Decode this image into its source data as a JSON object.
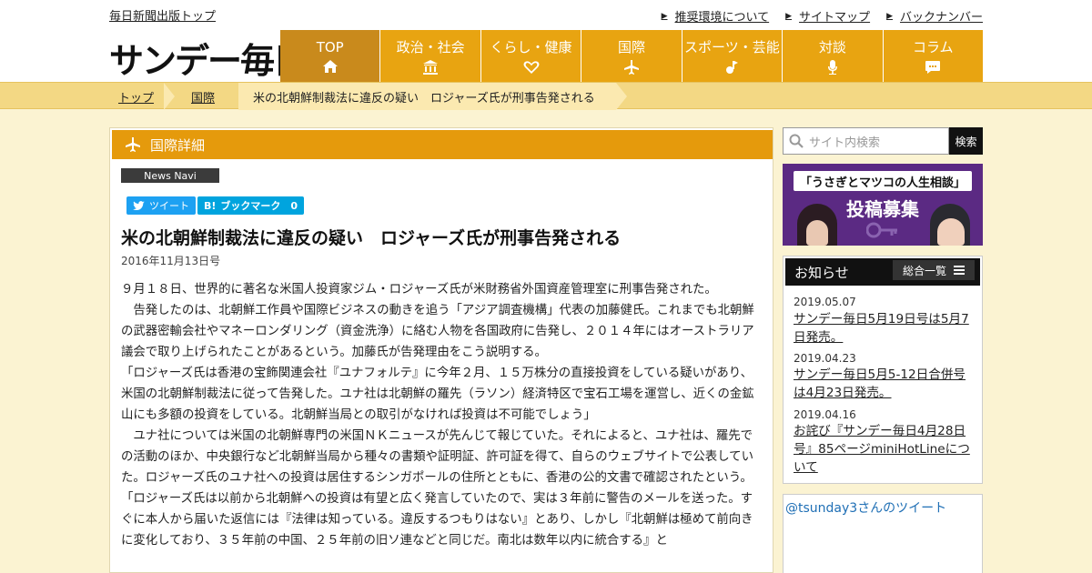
{
  "header": {
    "publisher_link": "毎日新聞出版トップ",
    "logo": "サンデー毎日",
    "util_links": [
      "推奨環境について",
      "サイトマップ",
      "バックナンバー"
    ]
  },
  "nav": [
    {
      "label": "TOP",
      "icon": "home-icon"
    },
    {
      "label": "政治・社会",
      "icon": "institution-icon"
    },
    {
      "label": "くらし・健康",
      "icon": "heart-icon"
    },
    {
      "label": "国際",
      "icon": "airplane-icon"
    },
    {
      "label": "スポーツ・芸能",
      "icon": "mic-note-icon"
    },
    {
      "label": "対談",
      "icon": "microphone-icon"
    },
    {
      "label": "コラム",
      "icon": "speech-bubble-icon"
    }
  ],
  "breadcrumb": {
    "home": "トップ",
    "category": "国際",
    "current": "米の北朝鮮制裁法に違反の疑い　ロジャーズ氏が刑事告発される"
  },
  "section": {
    "title": "国際詳細",
    "badge": "News Navi"
  },
  "share": {
    "tweet": "ツイート",
    "bookmark": "ブックマーク",
    "bookmark_count": "0"
  },
  "article": {
    "title": "米の北朝鮮制裁法に違反の疑い　ロジャーズ氏が刑事告発される",
    "date": "2016年11月13日号",
    "paragraphs": [
      "９月１８日、世界的に著名な米国人投資家ジム・ロジャーズ氏が米財務省外国資産管理室に刑事告発された。",
      "　告発したのは、北朝鮮工作員や国際ビジネスの動きを追う「アジア調査機構」代表の加藤健氏。これまでも北朝鮮の武器密輸会社やマネーロンダリング（資金洗浄）に絡む人物を各国政府に告発し、２０１４年にはオーストラリア議会で取り上げられたことがあるという。加藤氏が告発理由をこう説明する。",
      "「ロジャーズ氏は香港の宝飾関連会社『ユナフォルテ』に今年２月、１５万株分の直接投資をしている疑いがあり、米国の北朝鮮制裁法に従って告発した。ユナ社は北朝鮮の羅先（ラソン）経済特区で宝石工場を運営し、近くの金鉱山にも多額の投資をしている。北朝鮮当局との取引がなければ投資は不可能でしょう」",
      "　ユナ社については米国の北朝鮮専門の米国ＮＫニュースが先んじて報じていた。それによると、ユナ社は、羅先での活動のほか、中央銀行など北朝鮮当局から種々の書類や証明証、許可証を得て、自らのウェブサイトで公表していた。ロジャーズ氏のユナ社への投資は居住するシンガポールの住所とともに、香港の公的文書で確認されたという。",
      "「ロジャーズ氏は以前から北朝鮮への投資は有望と広く発言していたので、実は３年前に警告のメールを送った。すぐに本人から届いた返信には『法律は知っている。違反するつもりはない』とあり、しかし『北朝鮮は極めて前向きに変化しており、３５年前の中国、２５年前の旧ソ連などと同じだ。南北は数年以内に統合する』と"
    ]
  },
  "sidebar": {
    "search_placeholder": "サイト内検索",
    "search_button": "検索",
    "banner_line1": "「うさぎとマツコの人生相談」",
    "banner_line2": "投稿募集",
    "notice_title": "お知らせ",
    "notice_all": "総合一覧",
    "notices": [
      {
        "date": "2019.05.07",
        "text": "サンデー毎日5月19日号は5月7日発売。"
      },
      {
        "date": "2019.04.23",
        "text": "サンデー毎日5月5-12日合併号は4月23日発売。"
      },
      {
        "date": "2019.04.16",
        "text": "お詫び『サンデー毎日4月28日号』85ページminiHotLineについて"
      }
    ],
    "tweets_title": "@tsunday3さんのツイート"
  }
}
